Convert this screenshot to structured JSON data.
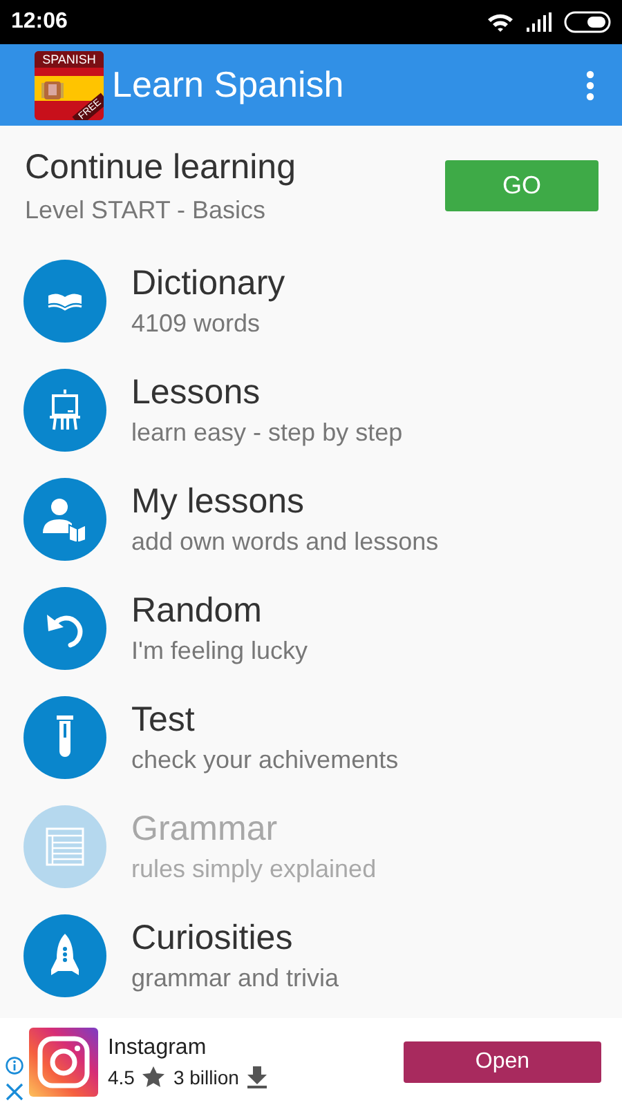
{
  "status_bar": {
    "time": "12:06"
  },
  "app_bar": {
    "logo_top": "SPANISH",
    "logo_corner": "FREE",
    "title": "Learn Spanish"
  },
  "continue": {
    "title": "Continue learning",
    "subtitle": "Level START - Basics",
    "button": "GO"
  },
  "menu": [
    {
      "kind": "book",
      "title": "Dictionary",
      "subtitle": "4109 words",
      "disabled": false
    },
    {
      "kind": "easel",
      "title": "Lessons",
      "subtitle": "learn easy - step by step",
      "disabled": false
    },
    {
      "kind": "reader",
      "title": "My lessons",
      "subtitle": "add own words and lessons",
      "disabled": false
    },
    {
      "kind": "undo",
      "title": "Random",
      "subtitle": "I'm feeling lucky",
      "disabled": false
    },
    {
      "kind": "tube",
      "title": "Test",
      "subtitle": "check your achivements",
      "disabled": false
    },
    {
      "kind": "list",
      "title": "Grammar",
      "subtitle": "rules simply explained",
      "disabled": true
    },
    {
      "kind": "rocket",
      "title": "Curiosities",
      "subtitle": "grammar and trivia",
      "disabled": false
    }
  ],
  "ad": {
    "app": "Instagram",
    "rating": "4.5",
    "downloads": "3 billion",
    "button": "Open"
  }
}
